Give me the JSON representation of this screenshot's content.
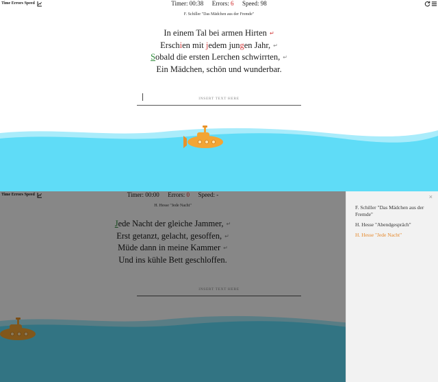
{
  "top": {
    "stats_link": "Time Errors Speed",
    "timer_label": "Timer:",
    "timer_value": "00:38",
    "errors_label": "Errors:",
    "errors_value": "6",
    "speed_label": "Speed:",
    "speed_value": "98",
    "icons": {
      "left": "reload-icon",
      "right": "menu-icon"
    },
    "poem_title": "F. Schiller \"Das Mädchen aus der Fremde\"",
    "lines": {
      "l1": "In einem Tal bei armen Hirten",
      "l2a": "Ersch",
      "l2b": "i",
      "l2c": "en mit ",
      "l2d": "j",
      "l2e": "edem jun",
      "l2f": "g",
      "l2g": "en Jahr,",
      "l3a": "S",
      "l3b": "obald die ersten Lerchen schwirrten,",
      "l4": "Ein Mädchen, schön und wunderbar."
    },
    "return_symbol": "↵",
    "input_placeholder": "INSERT TEXT HERE"
  },
  "bottom": {
    "stats_link": "Time Errors Speed",
    "timer_label": "Timer:",
    "timer_value": "00:00",
    "errors_label": "Errors:",
    "errors_value": "0",
    "speed_label": "Speed:",
    "speed_value": "-",
    "poem_title": "H. Hesse \"Jede Nacht\"",
    "lines": {
      "l1a": "J",
      "l1b": "ede Nacht der gleiche Jammer,",
      "l2": "Erst getanzt, gelacht, gesoffen,",
      "l3": "Müde dann in meine Kammer",
      "l4": "Und ins kühle Bett geschloffen."
    },
    "return_symbol": "↵",
    "input_placeholder": "INSERT TEXT HERE"
  },
  "sidebar": {
    "close_symbol": "×",
    "items": [
      {
        "label": "F. Schiller \"Das Mädchen aus der Fremde\""
      },
      {
        "label": "H. Hesse \"Abendgespräch\""
      },
      {
        "label": "H. Hesse \"Jede Nacht\""
      }
    ],
    "active_color": "#e5882b"
  },
  "colors": {
    "sea_light": "#5fdcf7",
    "sea_dark_overlay": "#0c4a58",
    "submarine": "#f3a534",
    "error_red": "#cc1f1f",
    "ok_green": "#2e8b3a"
  }
}
